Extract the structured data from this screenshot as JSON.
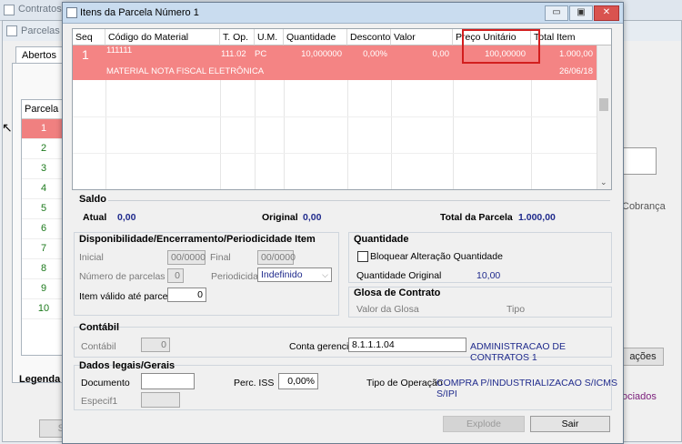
{
  "background": {
    "window_title": "Contratos",
    "inner_title": "Parcelas d",
    "tab_abertos": "Abertos",
    "parcela_header": "Parcela",
    "parcela_rows": [
      "1",
      "2",
      "3",
      "4",
      "5",
      "6",
      "7",
      "8",
      "9",
      "10"
    ],
    "legend_label": "Legenda",
    "right_cobranca": "Cobrança",
    "right_btn": "ações",
    "right_link": "ociados",
    "bottom_btn": "SLA"
  },
  "dialog": {
    "title": "Itens da Parcela Número 1",
    "window_buttons": [
      "▭",
      "▣",
      "✕"
    ]
  },
  "grid": {
    "columns": [
      "Seq",
      "Código do Material",
      "T. Op.",
      "U.M.",
      "Quantidade",
      "Desconto",
      "Valor Desconto",
      "Preço Unitário",
      "Total Item"
    ],
    "row": {
      "seq": "1",
      "codigo": "111111",
      "top": "111.02",
      "um": "PC",
      "quantidade": "10,000000",
      "desconto": "0,00%",
      "valor_desconto": "0,00",
      "preco_unitario": "100,00000",
      "total_item": "1.000,00",
      "descricao": "MATERIAL NOTA FISCAL ELETRÔNICA",
      "data": "26/06/18"
    }
  },
  "saldo": {
    "title": "Saldo",
    "atual_label": "Atual",
    "atual_value": "0,00",
    "original_label": "Original",
    "original_value": "0,00",
    "total_label": "Total da Parcela",
    "total_value": "1.000,00"
  },
  "disponibilidade": {
    "title": "Disponibilidade/Encerramento/Periodicidade Item",
    "inicial_label": "Inicial",
    "inicial_value": "00/0000",
    "final_label": "Final",
    "final_value": "00/0000",
    "num_parcelas_label": "Número de parcelas",
    "num_parcelas_value": "0",
    "periodicidade_label": "Periodicidade",
    "periodicidade_value": "Indefinido",
    "item_valido_label": "Item válido até parcela",
    "item_valido_value": "0"
  },
  "quantidade": {
    "title": "Quantidade",
    "bloquear_label": "Bloquear Alteração Quantidade",
    "original_label": "Quantidade Original",
    "original_value": "10,00"
  },
  "glosa": {
    "title": "Glosa de Contrato",
    "valor_label": "Valor da Glosa",
    "tipo_label": "Tipo"
  },
  "contabil": {
    "title": "Contábil",
    "contabil_label": "Contábil",
    "contabil_value": "0",
    "conta_label": "Conta gerencial",
    "conta_value": "8.1.1.1.04",
    "conta_desc": "ADMINISTRACAO DE CONTRATOS 1"
  },
  "dados_legais": {
    "title": "Dados legais/Gerais",
    "documento_label": "Documento",
    "documento_value": "",
    "perc_iss_label": "Perc. ISS",
    "perc_iss_value": "0,00%",
    "tipo_op_label": "Tipo de Operação",
    "tipo_op_value": "COMPRA P/INDUSTRIALIZACAO S/ICMS S/IPI",
    "especif_label": "Especif1",
    "especif_value": ""
  },
  "buttons": {
    "explode": "Explode",
    "sair": "Sair"
  }
}
